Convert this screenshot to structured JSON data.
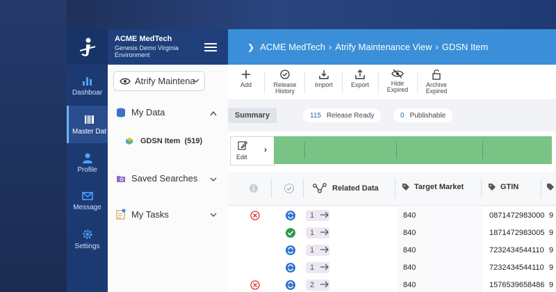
{
  "colors": {
    "accent": "#3a8fd8",
    "rail": "#1c3a72",
    "header": "#1f3f7a",
    "green_bar": "#79c485"
  },
  "rail": {
    "items": [
      {
        "label": "Dashboar",
        "icon": "bar-chart-icon"
      },
      {
        "label": "Master Dat",
        "icon": "barcode-icon"
      },
      {
        "label": "Profile",
        "icon": "user-icon"
      },
      {
        "label": "Message",
        "icon": "envelope-icon"
      },
      {
        "label": "Settings",
        "icon": "gear-icon"
      }
    ]
  },
  "panel": {
    "org": "ACME MedTech",
    "env": "Genesis Demo Virginia Environment",
    "selector": "Atrify Maintena",
    "my_data": "My Data",
    "gdsn_item": "GDSN Item",
    "gdsn_count": "(519)",
    "saved_searches": "Saved Searches",
    "my_tasks": "My Tasks"
  },
  "breadcrumb": {
    "items": [
      "ACME MedTech",
      "Atrify Maintenance View",
      "GDSN Item"
    ]
  },
  "toolbar": {
    "add": "Add",
    "release_history_1": "Release",
    "release_history_2": "History",
    "import": "Import",
    "export": "Export",
    "hide_expired_1": "Hide",
    "hide_expired_2": "Expired",
    "archive_expired_1": "Archive",
    "archive_expired_2": "Expired"
  },
  "summary": {
    "tab": "Summary",
    "release_ready_count": "115",
    "release_ready_label": "Release Ready",
    "publishable_count": "0",
    "publishable_label": "Publishable"
  },
  "edit": {
    "label": "Edit"
  },
  "grid": {
    "headers": {
      "related": "Related Data",
      "target_market": "Target Market",
      "gtin": "GTIN"
    },
    "rows": [
      {
        "error": true,
        "status": "blue",
        "related": "1",
        "target_market": "840",
        "gtin": "0871472983000",
        "more": "9"
      },
      {
        "error": false,
        "status": "green",
        "related": "1",
        "target_market": "840",
        "gtin": "1871472983005",
        "more": "9"
      },
      {
        "error": false,
        "status": "blue",
        "related": "1",
        "target_market": "840",
        "gtin": "7232434544110",
        "more": "9"
      },
      {
        "error": false,
        "status": "blue",
        "related": "1",
        "target_market": "840",
        "gtin": "7232434544110",
        "more": "9"
      },
      {
        "error": true,
        "status": "blue",
        "related": "2",
        "target_market": "840",
        "gtin": "1576539658486",
        "more": "9"
      }
    ]
  }
}
